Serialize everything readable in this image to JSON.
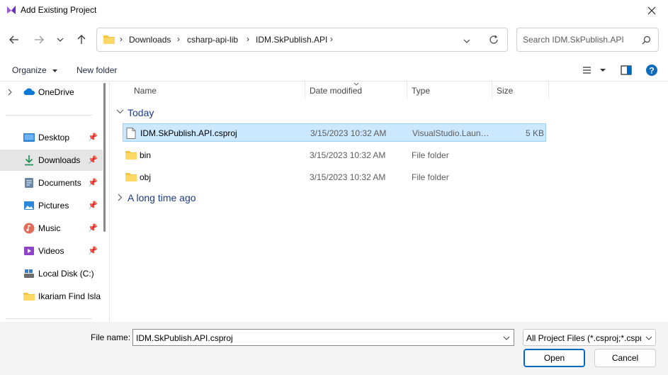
{
  "window": {
    "title": "Add Existing Project"
  },
  "address": {
    "crumbs": [
      "Downloads",
      "csharp-api-lib",
      "IDM.SkPublish.API"
    ]
  },
  "search": {
    "placeholder": "Search IDM.SkPublish.API"
  },
  "toolbar": {
    "organize_label": "Organize",
    "new_folder_label": "New folder"
  },
  "sidebar": {
    "onedrive": "OneDrive",
    "items": [
      {
        "label": "Desktop",
        "icon": "desktop-icon",
        "pinned": true
      },
      {
        "label": "Downloads",
        "icon": "download-icon",
        "pinned": true,
        "selected": true
      },
      {
        "label": "Documents",
        "icon": "documents-icon",
        "pinned": true
      },
      {
        "label": "Pictures",
        "icon": "pictures-icon",
        "pinned": true
      },
      {
        "label": "Music",
        "icon": "music-icon",
        "pinned": true
      },
      {
        "label": "Videos",
        "icon": "videos-icon",
        "pinned": true
      },
      {
        "label": "Local Disk (C:)",
        "icon": "drive-icon",
        "pinned": false
      },
      {
        "label": "Ikariam Find Isla",
        "icon": "folder-icon",
        "pinned": false
      }
    ]
  },
  "columns": {
    "name": "Name",
    "date": "Date modified",
    "type": "Type",
    "size": "Size"
  },
  "groups": {
    "today": "Today",
    "older": "A long time ago"
  },
  "files": [
    {
      "name": "IDM.SkPublish.API.csproj",
      "date": "3/15/2023 10:32 AM",
      "type": "VisualStudio.Launcher.csproj",
      "size": "5 KB",
      "icon": "file-icon",
      "selected": true
    },
    {
      "name": "bin",
      "date": "3/15/2023 10:32 AM",
      "type": "File folder",
      "size": "",
      "icon": "folder-icon"
    },
    {
      "name": "obj",
      "date": "3/15/2023 10:32 AM",
      "type": "File folder",
      "size": "",
      "icon": "folder-icon"
    }
  ],
  "footer": {
    "filename_label": "File name:",
    "filename_value": "IDM.SkPublish.API.csproj",
    "filetype_value": "All Project Files (*.csproj;*.csproj)",
    "open_label": "Open",
    "cancel_label": "Cancel"
  },
  "colors": {
    "accent": "#0067c0",
    "selection": "#cce8ff",
    "group_header": "#1e3a8a",
    "folder": "#f4c542"
  }
}
